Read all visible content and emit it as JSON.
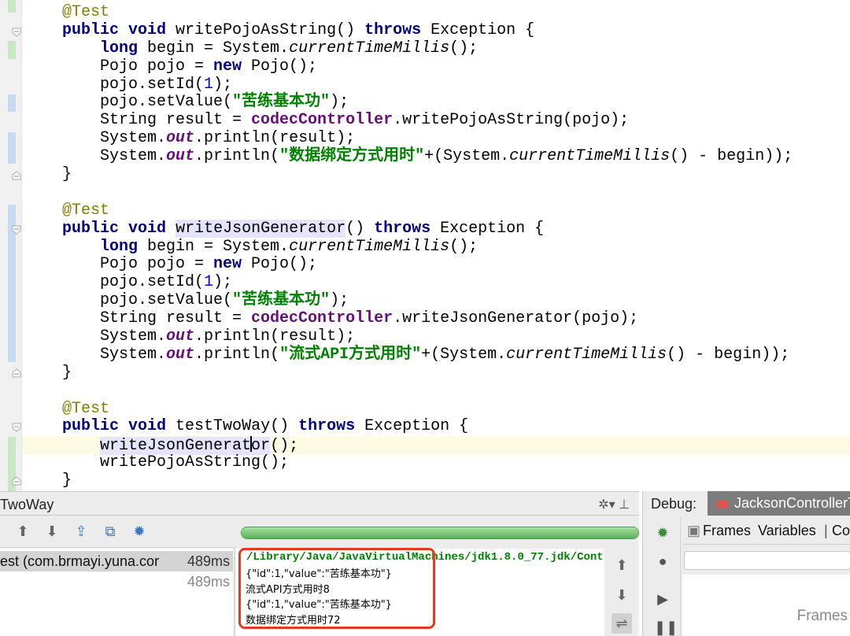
{
  "code_lines": [
    "@Test",
    "public void writePojoAsString() throws Exception {",
    "    long begin = System.currentTimeMillis();",
    "    Pojo pojo = new Pojo();",
    "    pojo.setId(1);",
    "    pojo.setValue(\"苦练基本功\");",
    "    String result = codecController.writePojoAsString(pojo);",
    "    System.out.println(result);",
    "    System.out.println(\"数据绑定方式用时\"+(System.currentTimeMillis() - begin));",
    "}",
    "",
    "@Test",
    "public void writeJsonGenerator() throws Exception {",
    "    long begin = System.currentTimeMillis();",
    "    Pojo pojo = new Pojo();",
    "    pojo.setId(1);",
    "    pojo.setValue(\"苦练基本功\");",
    "    String result = codecController.writeJsonGenerator(pojo);",
    "    System.out.println(result);",
    "    System.out.println(\"流式API方式用时\"+(System.currentTimeMillis() - begin));",
    "}",
    "",
    "@Test",
    "public void testTwoWay() throws Exception {",
    "    writeJsonGenerator();",
    "    writePojoAsString();",
    "}"
  ],
  "run_panel": {
    "title": "TwoWay",
    "header_tools": "✲▾ ⊥",
    "tests": [
      {
        "name": "est (com.brmayi.yuna.cor",
        "time": "489ms"
      },
      {
        "name": "",
        "time": "489ms"
      }
    ],
    "progress": 1.0,
    "console": {
      "command": "/Library/Java/JavaVirtualMachines/jdk1.8.0_77.jdk/Cont",
      "lines": [
        "{\"id\":1,\"value\":\"苦练基本功\"}",
        "流式API方式用时8",
        "{\"id\":1,\"value\":\"苦练基本功\"}",
        "数据绑定方式用时72"
      ]
    }
  },
  "debug_panel": {
    "label": "Debug:",
    "config_tab": "JacksonControllerT",
    "tabs": {
      "frames": "Frames",
      "variables": "Variables",
      "separator": "|",
      "console": "Co"
    },
    "frames_empty": "Frames"
  },
  "colors": {
    "keyword": "#000080",
    "annotation": "#808000",
    "string": "#008000",
    "number": "#0000ff",
    "field": "#660e7a",
    "highlight_box": "#e03c22",
    "progress": "#5cae5a"
  },
  "icons": [
    "up-arrow-icon",
    "down-arrow-icon",
    "export-icon",
    "history-icon",
    "settings-icon",
    "bug-icon",
    "scroll-icon",
    "wrap-icon",
    "resume-icon",
    "pause-icon"
  ]
}
